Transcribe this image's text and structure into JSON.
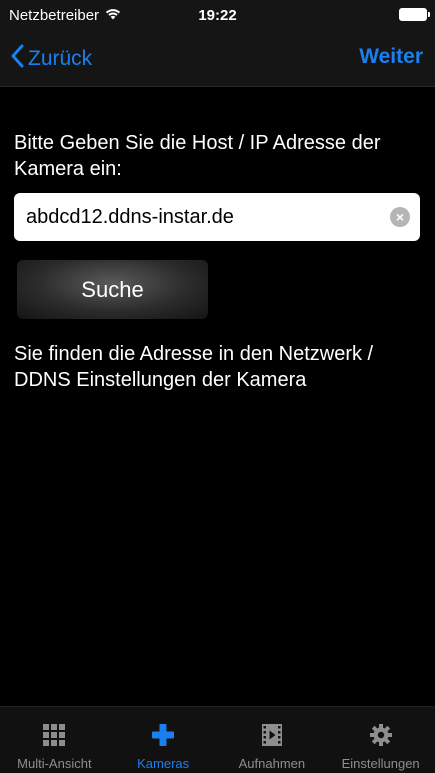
{
  "status_bar": {
    "carrier": "Netzbetreiber",
    "time": "19:22",
    "wifi_icon": "wifi-icon",
    "battery_icon": "battery-icon"
  },
  "nav": {
    "back_label": "Zurück",
    "next_label": "Weiter",
    "accent_color": "#1a7ff0"
  },
  "content": {
    "prompt": "Bitte Geben Sie die Host / IP Adresse der Kamera ein:",
    "host_value": "abdcd12.ddns-instar.de",
    "search_label": "Suche",
    "hint": "Sie finden die Adresse in den Netzwerk / DDNS Einstellungen der Kamera"
  },
  "tabs": [
    {
      "label": "Multi-Ansicht",
      "icon": "grid-icon",
      "active": false
    },
    {
      "label": "Kameras",
      "icon": "plus-icon",
      "active": true
    },
    {
      "label": "Aufnahmen",
      "icon": "film-icon",
      "active": false
    },
    {
      "label": "Einstellungen",
      "icon": "gear-icon",
      "active": false
    }
  ]
}
